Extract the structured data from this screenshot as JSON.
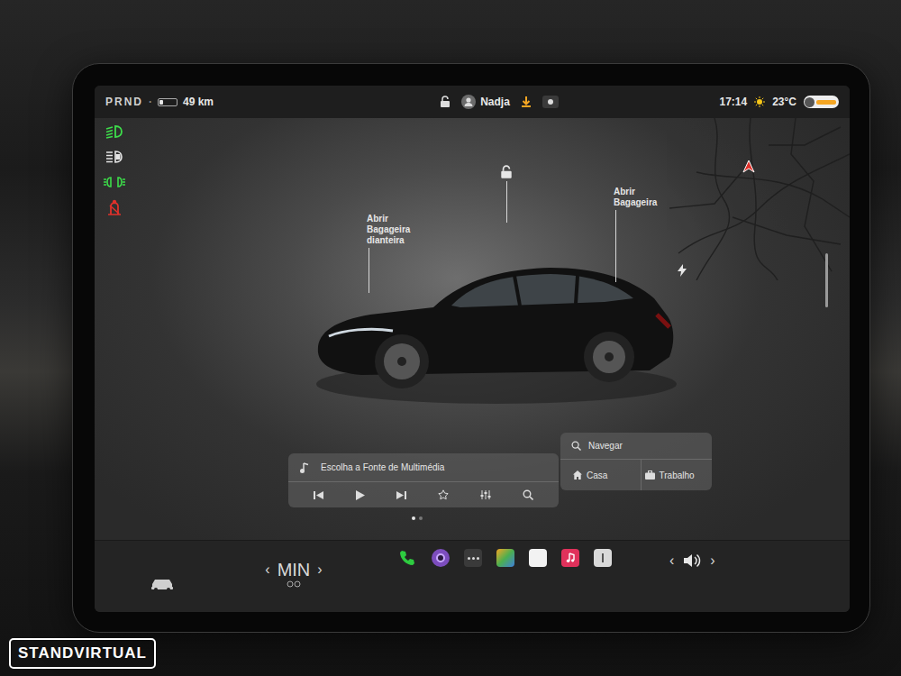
{
  "status_bar": {
    "gear": "PRND",
    "separator": "·",
    "range": "49 km",
    "user": "Nadja",
    "time": "17:14",
    "temperature": "23°C"
  },
  "indicators": [
    {
      "kind": "lowbeam",
      "color": "#3ddc4a"
    },
    {
      "kind": "autohighbeam",
      "color": "#e5e5e5"
    },
    {
      "kind": "parkinglights",
      "color": "#3ddc4a"
    },
    {
      "kind": "seatbelt",
      "color": "#e0312b"
    }
  ],
  "vehicle": {
    "callouts": [
      {
        "label": "Abrir Bagageira dianteira"
      },
      {
        "label": "Abrir Bagageira"
      }
    ]
  },
  "media": {
    "source": "Escolha a Fonte de Multimédia",
    "pages": [
      {
        "selected": true
      },
      {
        "selected": false
      }
    ]
  },
  "navigation": {
    "search": "Navegar",
    "shortcuts": [
      "Casa",
      "Trabalho"
    ]
  },
  "climate": {
    "left_arrow": "‹",
    "value": "MIN",
    "right_arrow": "›"
  },
  "volume": {
    "left_arrow": "‹",
    "right_arrow": "›"
  },
  "watermark": "STANDVIRTUAL"
}
